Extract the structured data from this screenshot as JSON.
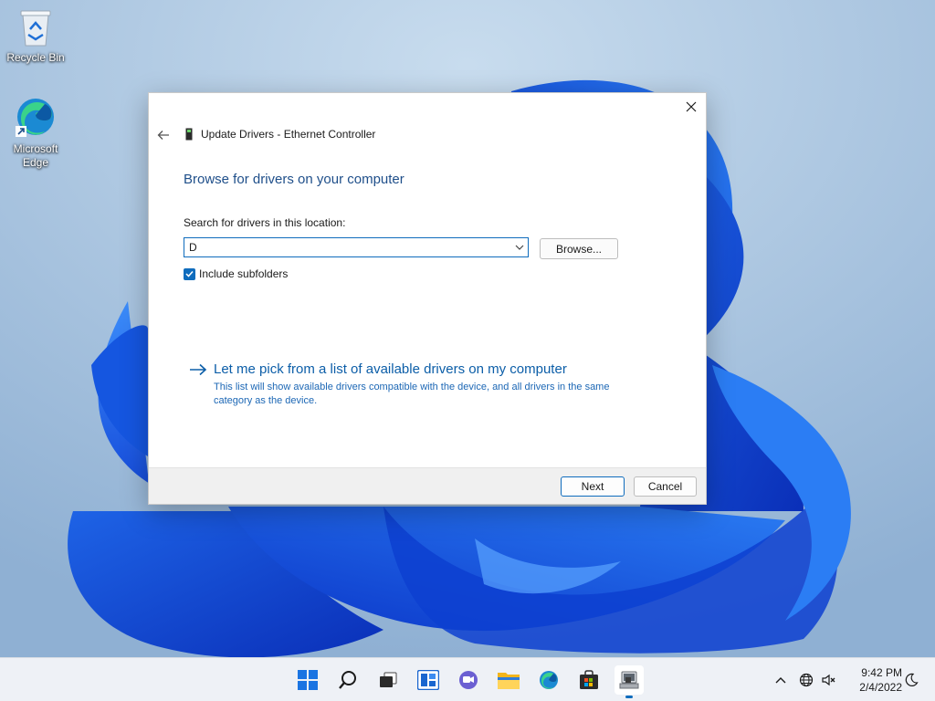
{
  "desktop": {
    "icons": [
      {
        "label": "Recycle Bin",
        "icon": "recycle-bin-icon"
      },
      {
        "label": "Microsoft Edge",
        "icon": "edge-icon"
      }
    ]
  },
  "dialog": {
    "title": "Update Drivers - Ethernet Controller",
    "heading": "Browse for drivers on your computer",
    "search_label": "Search for drivers in this location:",
    "path_value": "D",
    "browse_label": "Browse...",
    "include_subfolders_label": "Include subfolders",
    "include_subfolders_checked": true,
    "pick_link_title": "Let me pick from a list of available drivers on my computer",
    "pick_link_desc": "This list will show available drivers compatible with the device, and all drivers in the same category as the device.",
    "next_label": "Next",
    "cancel_label": "Cancel"
  },
  "taskbar": {
    "apps": [
      "start-icon",
      "search-icon",
      "task-view-icon",
      "widgets-icon",
      "chat-icon",
      "file-explorer-icon",
      "edge-icon",
      "store-icon",
      "device-manager-icon"
    ],
    "active_app": "device-manager-icon"
  },
  "tray": {
    "time": "9:42 PM",
    "date": "2/4/2022",
    "icons": [
      "chevron-up-icon",
      "network-globe-icon",
      "speaker-muted-icon",
      "moon-icon"
    ]
  },
  "colors": {
    "accent": "#0f6cbd",
    "heading": "#1f4f8a",
    "link": "#0c5ea8"
  }
}
